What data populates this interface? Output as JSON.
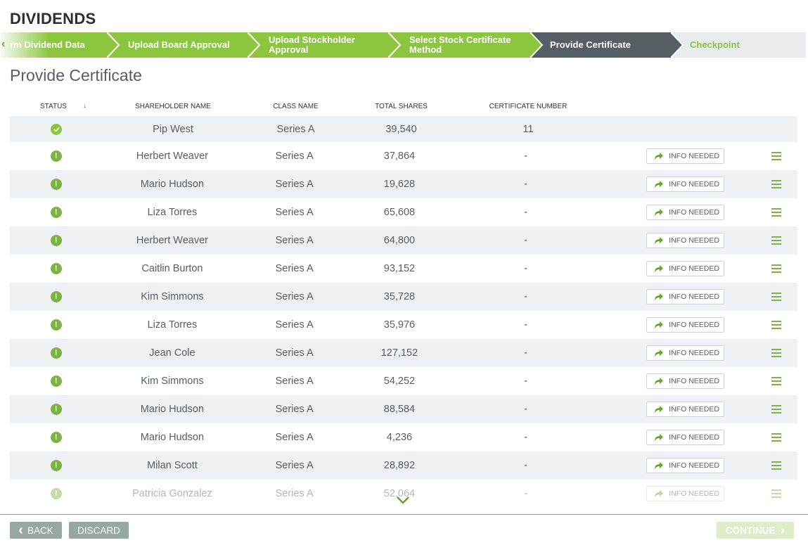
{
  "app": {
    "title": "DIVIDENDS"
  },
  "stepper": {
    "scroll_left_icon": "‹",
    "steps": [
      {
        "label": "rm Dividend Data",
        "state": "complete"
      },
      {
        "label": "Upload Board Approval",
        "state": "complete"
      },
      {
        "label": "Upload Stockholder Approval",
        "state": "complete"
      },
      {
        "label": "Select Stock Certificate Method",
        "state": "complete"
      },
      {
        "label": "Provide Certificate",
        "state": "current"
      },
      {
        "label": "Checkpoint",
        "state": "upcoming"
      }
    ]
  },
  "section": {
    "title": "Provide Certificate"
  },
  "table": {
    "columns": {
      "status": "STATUS",
      "sort_icon": "↓",
      "shareholder": "SHAREHOLDER NAME",
      "class": "CLASS NAME",
      "shares": "TOTAL SHARES",
      "certificate": "CERTIFICATE NUMBER"
    },
    "action_label": "INFO NEEDED",
    "rows": [
      {
        "status": "complete",
        "name": "Pip West",
        "class": "Series A",
        "shares": "39,540",
        "certificate": "11"
      },
      {
        "status": "warning",
        "name": "Herbert Weaver",
        "class": "Series A",
        "shares": "37,864",
        "certificate": "-"
      },
      {
        "status": "warning",
        "name": "Mario Hudson",
        "class": "Series A",
        "shares": "19,628",
        "certificate": "-"
      },
      {
        "status": "warning",
        "name": "Liza Torres",
        "class": "Series A",
        "shares": "65,608",
        "certificate": "-"
      },
      {
        "status": "warning",
        "name": "Herbert Weaver",
        "class": "Series A",
        "shares": "64,800",
        "certificate": "-"
      },
      {
        "status": "warning",
        "name": "Caitlin Burton",
        "class": "Series A",
        "shares": "93,152",
        "certificate": "-"
      },
      {
        "status": "warning",
        "name": "Kim Simmons",
        "class": "Series A",
        "shares": "35,728",
        "certificate": "-"
      },
      {
        "status": "warning",
        "name": "Liza Torres",
        "class": "Series A",
        "shares": "35,976",
        "certificate": "-"
      },
      {
        "status": "warning",
        "name": "Jean Cole",
        "class": "Series A",
        "shares": "127,152",
        "certificate": "-"
      },
      {
        "status": "warning",
        "name": "Kim Simmons",
        "class": "Series A",
        "shares": "54,252",
        "certificate": "-"
      },
      {
        "status": "warning",
        "name": "Mario Hudson",
        "class": "Series A",
        "shares": "88,584",
        "certificate": "-"
      },
      {
        "status": "warning",
        "name": "Mario Hudson",
        "class": "Series A",
        "shares": "4,236",
        "certificate": "-"
      },
      {
        "status": "warning",
        "name": "Milan Scott",
        "class": "Series A",
        "shares": "28,892",
        "certificate": "-"
      },
      {
        "status": "warning",
        "name": "Patricia Gonzalez",
        "class": "Series A",
        "shares": "52,064",
        "certificate": "-"
      }
    ]
  },
  "footer": {
    "back_label": "BACK",
    "back_icon": "‹",
    "discard_label": "DISCARD",
    "continue_label": "CONTINUE",
    "continue_icon": "›"
  },
  "colors": {
    "accent_green": "#8cc63f",
    "current_step": "#555f63",
    "upcoming_step": "#e9eced",
    "button_gray": "#96a8a4"
  }
}
